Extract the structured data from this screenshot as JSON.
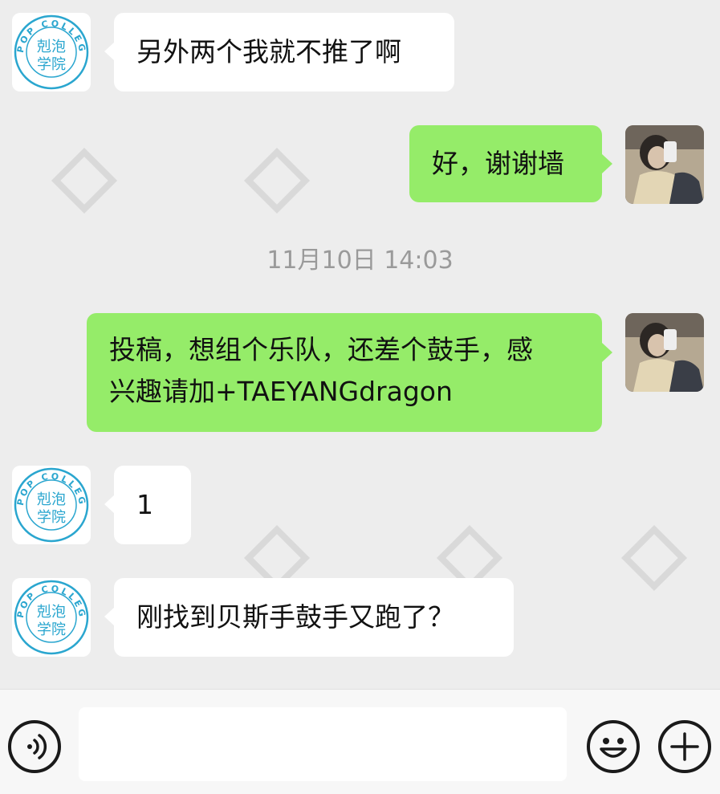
{
  "messages": [
    {
      "side": "left",
      "text": "另外两个我就不推了啊"
    },
    {
      "side": "right",
      "text": "好，谢谢墙"
    },
    {
      "side": "right",
      "line1": "投稿，想组个乐队，还差个鼓手，感",
      "line2": "兴趣请加+TAEYANGdragon"
    },
    {
      "side": "left",
      "text": "1"
    },
    {
      "side": "left",
      "text": "刚找到贝斯手鼓手又跑了？"
    }
  ],
  "timestamp": "11月10日 14:03",
  "avatar_bot": {
    "top_text": "KPOP COLLEGE",
    "line1": "剋泡",
    "line2": "学院",
    "color": "#2aa6cf"
  },
  "colors": {
    "background": "#ededed",
    "bubble_green": "#95ec69",
    "bubble_white": "#ffffff",
    "icon": "#1a1a1a"
  },
  "icons": [
    "voice-icon",
    "emoji-icon",
    "plus-icon"
  ]
}
